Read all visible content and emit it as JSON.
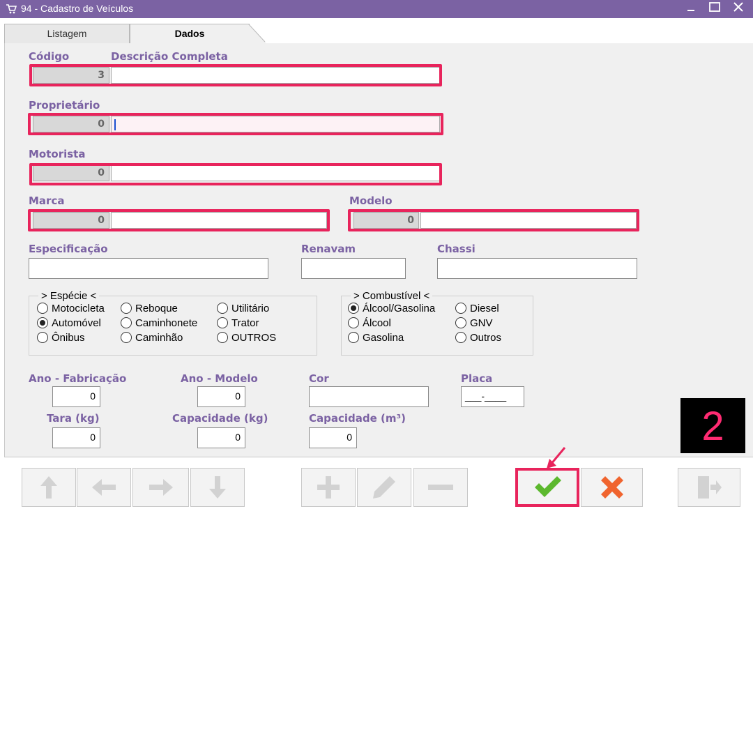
{
  "window": {
    "title": "94 - Cadastro de Veículos"
  },
  "tabs": [
    {
      "label": "Listagem",
      "active": false
    },
    {
      "label": "Dados",
      "active": true
    }
  ],
  "form": {
    "codigo_label": "Código",
    "descricao_label": "Descrição Completa",
    "codigo_value": "3",
    "descricao_value": "",
    "proprietario_label": "Proprietário",
    "proprietario_code": "0",
    "proprietario_value": "",
    "motorista_label": "Motorista",
    "motorista_code": "0",
    "motorista_value": "",
    "marca_label": "Marca",
    "marca_code": "0",
    "modelo_label": "Modelo",
    "modelo_code": "0",
    "especificacao_label": "Especificação",
    "especificacao_value": "",
    "renavam_label": "Renavam",
    "renavam_value": "",
    "chassi_label": "Chassi",
    "chassi_value": "",
    "especie": {
      "title": "> Espécie <",
      "options": [
        "Motocicleta",
        "Reboque",
        "Utilitário",
        "Automóvel",
        "Caminhonete",
        "Trator",
        "Ônibus",
        "Caminhão",
        "OUTROS"
      ],
      "selected": "Automóvel"
    },
    "combustivel": {
      "title": "> Combustível <",
      "options": [
        "Álcool/Gasolina",
        "Diesel",
        "Álcool",
        "GNV",
        "Gasolina",
        "Outros"
      ],
      "selected": "Álcool/Gasolina"
    },
    "ano_fabricacao_label": "Ano - Fabricação",
    "ano_fabricacao_value": "0",
    "ano_modelo_label": "Ano - Modelo",
    "ano_modelo_value": "0",
    "cor_label": "Cor",
    "cor_value": "",
    "placa_label": "Placa",
    "placa_value": "___-____",
    "tara_label": "Tara (kg)",
    "tara_value": "0",
    "capacidade_kg_label": "Capacidade (kg)",
    "capacidade_kg_value": "0",
    "capacidade_m3_label": "Capacidade (m³)",
    "capacidade_m3_value": "0"
  },
  "annotation": {
    "step_number": "2"
  },
  "toolbar": {
    "icons": [
      "arrow-up-icon",
      "arrow-left-icon",
      "arrow-right-icon",
      "arrow-down-icon",
      "plus-icon",
      "pencil-icon",
      "minus-icon",
      "check-icon",
      "close-icon",
      "exit-icon"
    ]
  },
  "colors": {
    "accent": "#7b62a3",
    "highlight": "#e8245c",
    "confirm": "#5cb82e",
    "cancel": "#f0642e"
  }
}
